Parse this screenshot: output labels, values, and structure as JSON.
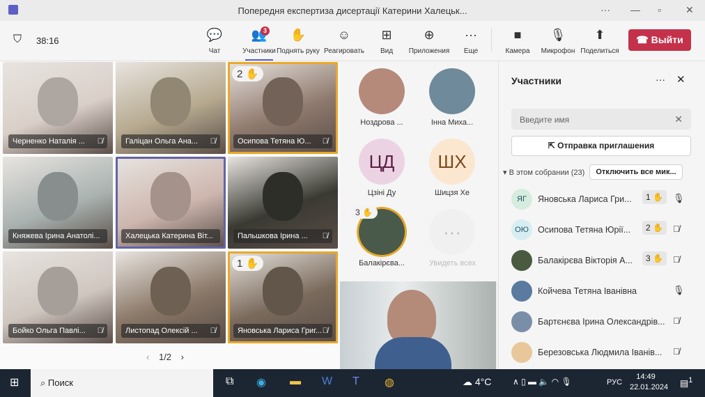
{
  "window": {
    "title": "Попередня експертиза дисертації Катерини Халецьк...",
    "more": "···",
    "minimize": "—",
    "restore": "▫",
    "close": "✕"
  },
  "toolbar": {
    "timer": "38:16",
    "participants_badge": "3",
    "items": [
      {
        "label": "Чат",
        "icon": "💬"
      },
      {
        "label": "Участники",
        "icon": "👥"
      },
      {
        "label": "Поднять руку",
        "icon": "✋"
      },
      {
        "label": "Реагировать",
        "icon": "☺"
      },
      {
        "label": "Вид",
        "icon": "⊞"
      },
      {
        "label": "Приложения",
        "icon": "⊕"
      },
      {
        "label": "Еще",
        "icon": "···"
      },
      {
        "label": "Камера",
        "icon": "■"
      },
      {
        "label": "Микрофон",
        "icon": "🎙"
      },
      {
        "label": "Поделиться",
        "icon": "⬆"
      }
    ],
    "leave_label": "Выйти"
  },
  "tiles": [
    {
      "name": "Черненко Наталія ...",
      "bg": "#d9cfc8"
    },
    {
      "name": "Галіцан Ольга Ана...",
      "bg": "#b6a98f"
    },
    {
      "name": "Осипова Тетяна Ю...",
      "bg": "#8f7a6e",
      "hand": "2 ✋"
    },
    {
      "name": "Княжева Ірина Анатолі...",
      "bg": "#a9b2b0"
    },
    {
      "name": "Халецька Катерина Віт...",
      "bg": "#cdb6ae"
    },
    {
      "name": "Пальшкова Ірина ...",
      "bg": "#3a3a32"
    },
    {
      "name": "Бойко Ольга Павлі...",
      "bg": "#cfc6bf"
    },
    {
      "name": "Листопад Олексій ...",
      "bg": "#8a7868"
    },
    {
      "name": "Яновська Лариса Григ...",
      "bg": "#7a6a5c",
      "hand": "1 ✋"
    }
  ],
  "pager": {
    "label": "1/2",
    "prev": "‹",
    "next": "›"
  },
  "rail": [
    {
      "name": "Ноздрова ...",
      "initials": "",
      "bg": "#b58a7a"
    },
    {
      "name": "Інна Миха...",
      "initials": "",
      "bg": "#6f8a9a"
    },
    {
      "name": "Цзіні Ду",
      "initials": "ЦД",
      "bg": "#ecd3e3",
      "fg": "#5a1f45"
    },
    {
      "name": "Шицзя Хе",
      "initials": "ШХ",
      "bg": "#fbe6d0",
      "fg": "#7a4a1a"
    },
    {
      "name": "Балакірєва...",
      "initials": "",
      "bg": "#4a5a4a",
      "hand": "3 ✋"
    },
    {
      "name": "Увидеть всех",
      "initials": "···",
      "bg": "#f0f0f0",
      "fg": "#bbb"
    }
  ],
  "panel": {
    "title": "Участники",
    "search_placeholder": "Введите имя",
    "invite_label": "Отправка приглашения",
    "group_label": "▾ В этом собрании (23)",
    "mute_all_label": "Отключить все мик...",
    "people": [
      {
        "name": "Яновська Лариса Гри...",
        "initials": "ЯГ",
        "bg": "#d5ecdf",
        "hand": "1 ✋",
        "mic": "on"
      },
      {
        "name": "Осипова Тетяна Юрії...",
        "initials": "ОЮ",
        "bg": "#d6eef2",
        "hand": "2 ✋",
        "mic": "off"
      },
      {
        "name": "Балакірєва Вікторія А...",
        "initials": "",
        "bg": "#4a5a40",
        "hand": "3 ✋",
        "mic": "off"
      },
      {
        "name": "Койчева Тетяна Іванівна",
        "initials": "",
        "bg": "#5a7aa0",
        "mic": "on"
      },
      {
        "name": "Бартєнєва Ірина Олександрів...",
        "initials": "",
        "bg": "#7a8ea8",
        "mic": "off"
      },
      {
        "name": "Березовська Людмила Іванів...",
        "initials": "",
        "bg": "#e8c89a",
        "mic": "off"
      }
    ]
  },
  "taskbar": {
    "search": "Поиск",
    "weather": "4°C",
    "lang": "РУС",
    "time": "14:49",
    "date": "22.01.2024",
    "notif": "1"
  }
}
